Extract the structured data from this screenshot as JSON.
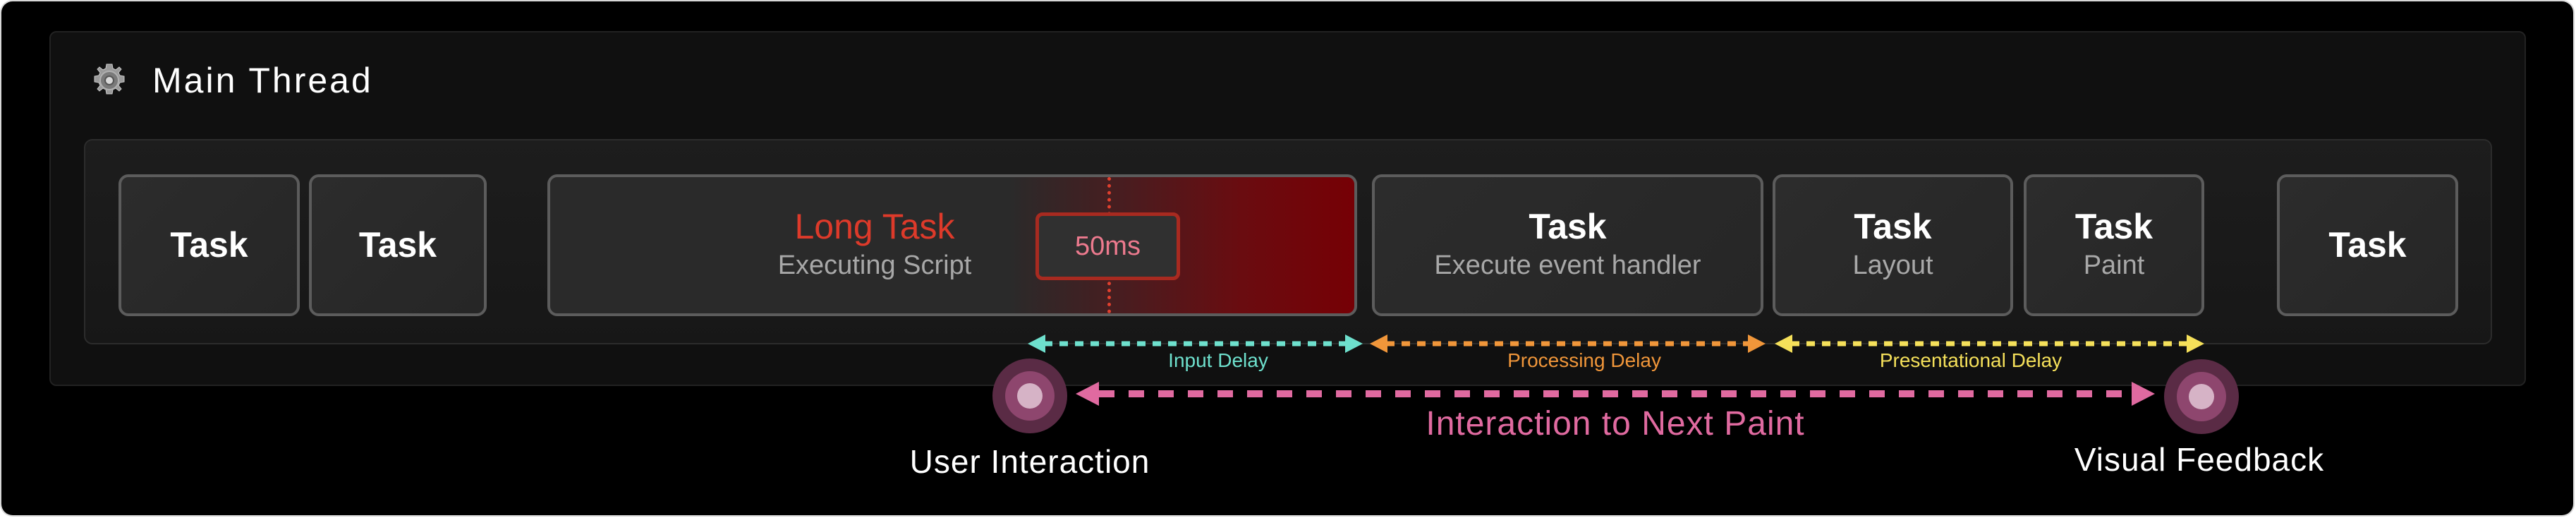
{
  "header": {
    "title": "Main Thread",
    "icon": "gear-icon"
  },
  "tasks": [
    {
      "name": "Task",
      "sub": ""
    },
    {
      "name": "Task",
      "sub": ""
    },
    {
      "name": "Long Task",
      "sub": "Executing Script",
      "threshold": "50ms"
    },
    {
      "name": "Task",
      "sub": "Execute event handler"
    },
    {
      "name": "Task",
      "sub": "Layout"
    },
    {
      "name": "Task",
      "sub": "Paint"
    },
    {
      "name": "Task",
      "sub": ""
    }
  ],
  "delays": [
    {
      "label": "Input Delay",
      "color": "#6ee0cd"
    },
    {
      "label": "Processing Delay",
      "color": "#f0963a"
    },
    {
      "label": "Presentational Delay",
      "color": "#f5e05a"
    }
  ],
  "inp": {
    "label": "Interaction to Next Paint",
    "color": "#e06aa0"
  },
  "events": {
    "start": "User Interaction",
    "end": "Visual Feedback"
  },
  "colors": {
    "long_task": "#dd3a2a",
    "threshold_border": "#a82a20",
    "marker_outer": "#5a2b45",
    "marker_mid": "#8e466e",
    "marker_inner": "#d6b3c6"
  }
}
